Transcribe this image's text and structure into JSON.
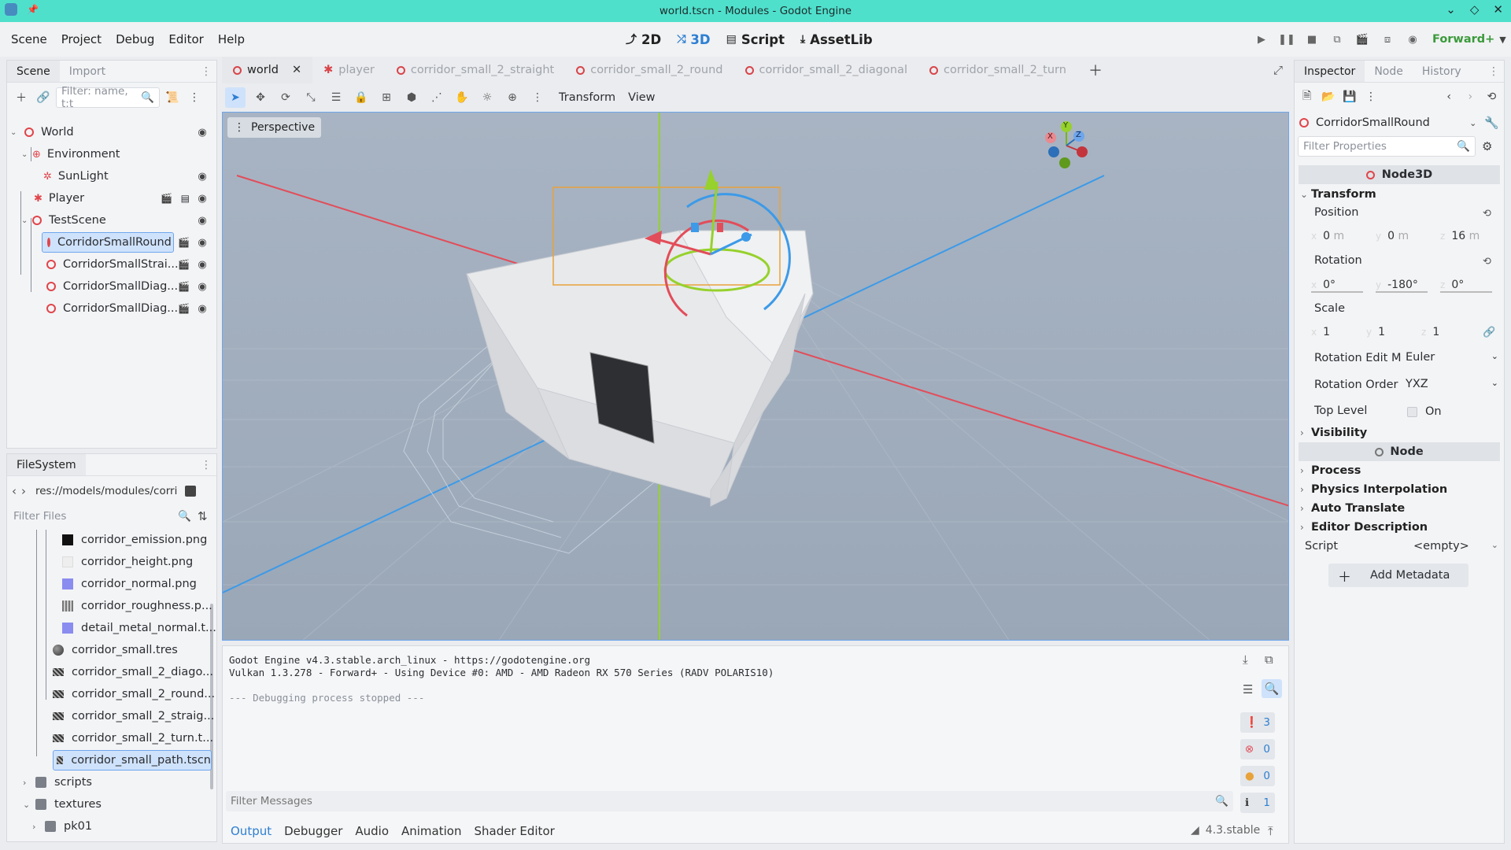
{
  "window": {
    "title": "world.tscn - Modules - Godot Engine"
  },
  "menu": [
    "Scene",
    "Project",
    "Debug",
    "Editor",
    "Help"
  ],
  "workspaces": {
    "w2d": "2D",
    "w3d": "3D",
    "script": "Script",
    "assetlib": "AssetLib"
  },
  "renderer": "Forward+",
  "scene_dock": {
    "tabs": [
      "Scene",
      "Import"
    ],
    "filter_placeholder": "Filter: name, t:t",
    "nodes": [
      {
        "label": "World",
        "icon": "node3d-icon"
      },
      {
        "label": "Environment",
        "icon": "environment-icon"
      },
      {
        "label": "SunLight",
        "icon": "sunlight-icon"
      },
      {
        "label": "Player",
        "icon": "player-icon"
      },
      {
        "label": "TestScene",
        "icon": "node3d-icon"
      },
      {
        "label": "CorridorSmallRound",
        "icon": "node3d-icon"
      },
      {
        "label": "CorridorSmallStrai...",
        "icon": "node3d-icon"
      },
      {
        "label": "CorridorSmallDiag...",
        "icon": "node3d-icon"
      },
      {
        "label": "CorridorSmallDiag...",
        "icon": "node3d-icon"
      }
    ]
  },
  "filesystem": {
    "title": "FileSystem",
    "path": "res://models/modules/corri",
    "filter_placeholder": "Filter Files",
    "items": [
      {
        "label": "corridor_emission.png",
        "icon": "image-black-icon"
      },
      {
        "label": "corridor_height.png",
        "icon": "image-light-icon"
      },
      {
        "label": "corridor_normal.png",
        "icon": "image-normal-icon"
      },
      {
        "label": "corridor_roughness.p...",
        "icon": "image-noise-icon"
      },
      {
        "label": "detail_metal_normal.t...",
        "icon": "image-normal-icon"
      },
      {
        "label": "corridor_small.tres",
        "icon": "material-icon"
      },
      {
        "label": "corridor_small_2_diago...",
        "icon": "scene-file-icon"
      },
      {
        "label": "corridor_small_2_round...",
        "icon": "scene-file-icon"
      },
      {
        "label": "corridor_small_2_straig...",
        "icon": "scene-file-icon"
      },
      {
        "label": "corridor_small_2_turn.t...",
        "icon": "scene-file-icon"
      },
      {
        "label": "corridor_small_path.tscn",
        "icon": "scene-file-icon"
      },
      {
        "label": "scripts",
        "icon": "folder-icon"
      },
      {
        "label": "textures",
        "icon": "folder-icon"
      },
      {
        "label": "pk01",
        "icon": "folder-icon"
      }
    ]
  },
  "scene_tabs": [
    "world",
    "player",
    "corridor_small_2_straight",
    "corridor_small_2_round",
    "corridor_small_2_diagonal",
    "corridor_small_2_turn"
  ],
  "viewport": {
    "toolbar_menus": [
      "Transform",
      "View"
    ],
    "perspective": "Perspective",
    "gizmo_axes": {
      "x": "X",
      "y": "Y",
      "z": "Z"
    }
  },
  "output": {
    "lines": [
      "Godot Engine v4.3.stable.arch_linux - https://godotengine.org",
      "Vulkan 1.3.278 - Forward+ - Using Device #0: AMD - AMD Radeon RX 570 Series (RADV POLARIS10)",
      "",
      "--- Debugging process stopped ---"
    ],
    "filter_placeholder": "Filter Messages",
    "counts": {
      "messages": "3",
      "errors": "0",
      "warnings": "0",
      "info": "1"
    },
    "bottom_tabs": [
      "Output",
      "Debugger",
      "Audio",
      "Animation",
      "Shader Editor"
    ],
    "version": "4.3.stable"
  },
  "inspector": {
    "tabs": [
      "Inspector",
      "Node",
      "History"
    ],
    "object": "CorridorSmallRound",
    "filter_placeholder": "Filter Properties",
    "class_header": "Node3D",
    "transform": {
      "title": "Transform",
      "position": {
        "label": "Position",
        "x": "0",
        "y": "0",
        "z": "16",
        "unit": "m"
      },
      "rotation": {
        "label": "Rotation",
        "x": "0",
        "y": "-180",
        "z": "0",
        "unit": "°"
      },
      "scale": {
        "label": "Scale",
        "x": "1",
        "y": "1",
        "z": "1"
      },
      "rotation_edit_mode": {
        "label": "Rotation Edit M",
        "value": "Euler"
      },
      "rotation_order": {
        "label": "Rotation Order",
        "value": "YXZ"
      },
      "top_level": {
        "label": "Top Level",
        "value": "On"
      }
    },
    "visibility": "Visibility",
    "node_header": "Node",
    "sections": [
      "Process",
      "Physics Interpolation",
      "Auto Translate",
      "Editor Description"
    ],
    "script": {
      "label": "Script",
      "value": "<empty>"
    },
    "add_metadata": "Add Metadata"
  }
}
